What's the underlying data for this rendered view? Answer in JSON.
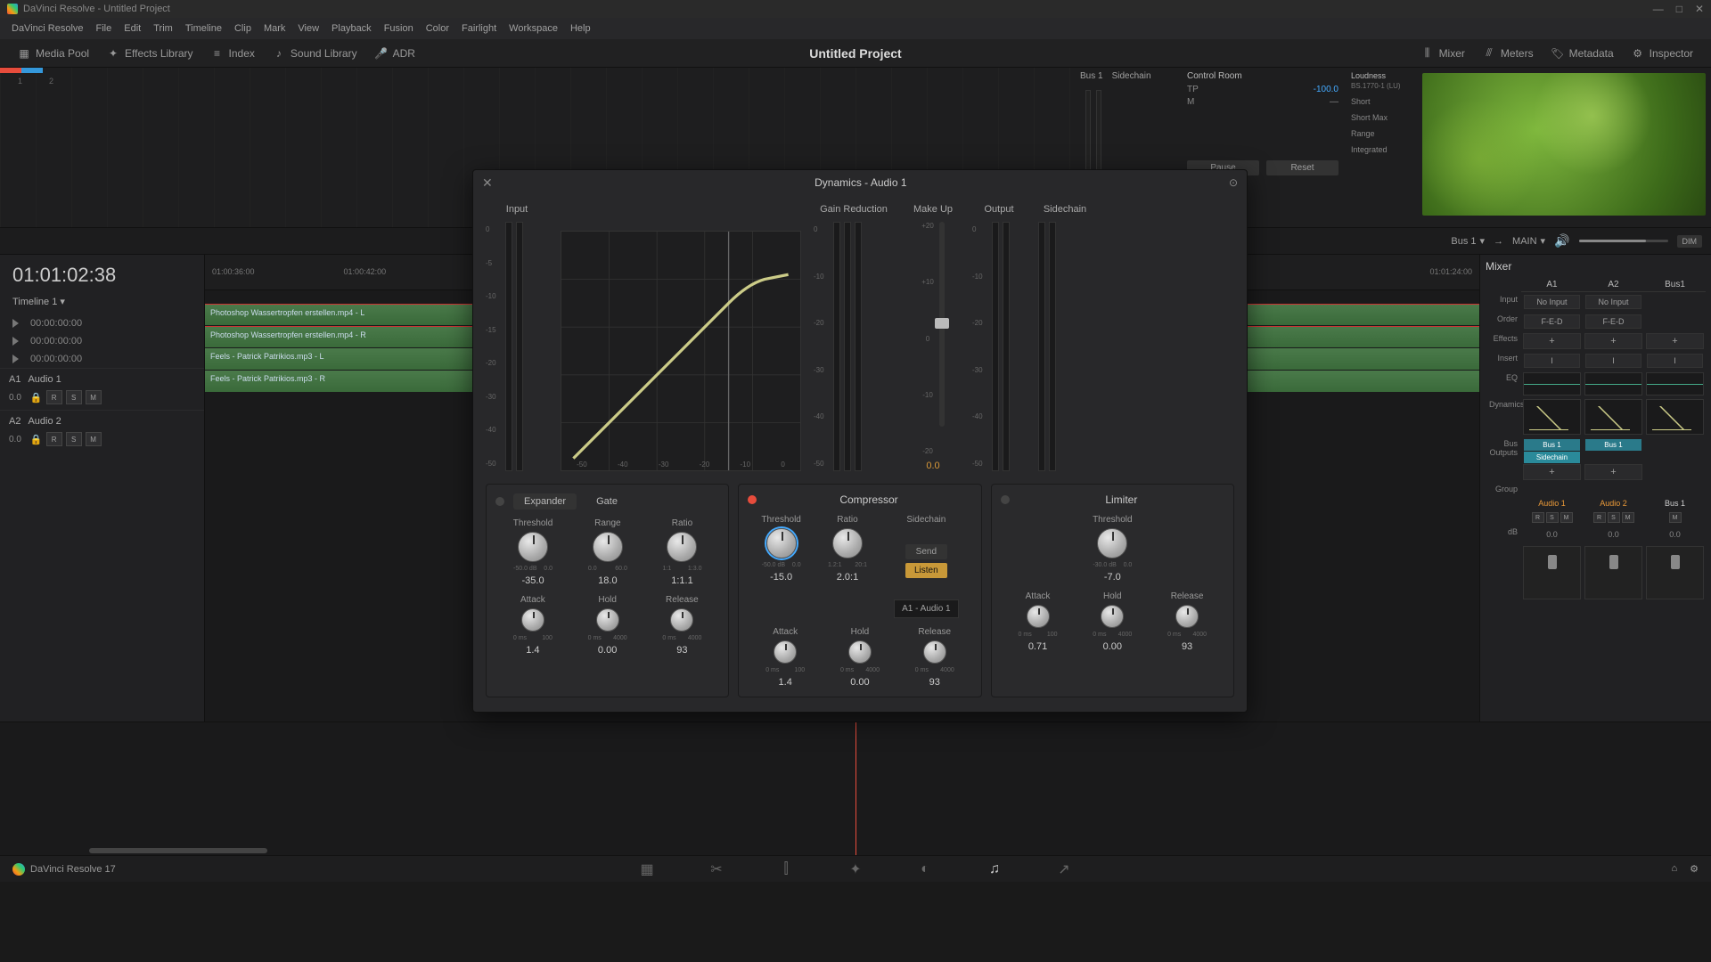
{
  "window": {
    "title": "DaVinci Resolve - Untitled Project"
  },
  "menubar": [
    "DaVinci Resolve",
    "File",
    "Edit",
    "Trim",
    "Timeline",
    "Clip",
    "Mark",
    "View",
    "Playback",
    "Fusion",
    "Color",
    "Fairlight",
    "Workspace",
    "Help"
  ],
  "toolbar": {
    "left": [
      "Media Pool",
      "Effects Library",
      "Index",
      "Sound Library",
      "ADR"
    ],
    "project": "Untitled Project",
    "right": [
      "Mixer",
      "Meters",
      "Metadata",
      "Inspector"
    ]
  },
  "control_room": {
    "bus": "Bus 1",
    "sidechain": "Sidechain",
    "title": "Control Room",
    "tp_label": "TP",
    "tp_value": "-100.0",
    "m_label": "M",
    "loudness_title": "Loudness",
    "loudness_std": "BS.1770-1 (LU)",
    "rows": [
      "Short",
      "Short Max",
      "Range",
      "Integrated"
    ],
    "pause": "Pause",
    "reset": "Reset"
  },
  "midstrip": {
    "bus": "Bus 1",
    "main": "MAIN",
    "dim": "DIM"
  },
  "timeline": {
    "tc": "01:01:02:38",
    "dropdown": "Timeline 1",
    "tc_rows": [
      "00:00:00:00",
      "00:00:00:00",
      "00:00:00:00"
    ],
    "ruler": [
      "01:00:36:00",
      "01:00:42:00",
      "01:01:24:00"
    ],
    "tracks": [
      {
        "id": "A1",
        "name": "Audio 1",
        "level": "0.0",
        "btns": [
          "R",
          "S",
          "M"
        ],
        "clips": [
          "Photoshop Wassertropfen erstellen.mp4 - L",
          "Photoshop Wassertropfen erstellen.mp4 - R"
        ]
      },
      {
        "id": "A2",
        "name": "Audio 2",
        "level": "0.0",
        "btns": [
          "R",
          "S",
          "M"
        ],
        "clips": [
          "Feels - Patrick Patrikios.mp3 - L",
          "Feels - Patrick Patrikios.mp3 - R"
        ]
      }
    ]
  },
  "mixer": {
    "title": "Mixer",
    "channels": [
      "A1",
      "A2",
      "Bus1"
    ],
    "rows": {
      "input": "Input",
      "order": "Order",
      "effects": "Effects",
      "insert": "Insert",
      "eq": "EQ",
      "dynamics": "Dynamics",
      "busout": "Bus Outputs",
      "group": "Group",
      "db": "dB"
    },
    "input_vals": [
      "No Input",
      "No Input",
      ""
    ],
    "order_vals": [
      "F-E-D",
      "F-E-D",
      ""
    ],
    "insert_vals": [
      "I",
      "I",
      "I"
    ],
    "busout": [
      "Bus 1",
      "Bus 1"
    ],
    "sidechain": "Sidechain",
    "names": [
      "Audio 1",
      "Audio 2",
      "Bus 1"
    ],
    "rsm": [
      "R",
      "S",
      "M"
    ],
    "db_vals": [
      "0.0",
      "0.0",
      "0.0"
    ]
  },
  "dynamics": {
    "title": "Dynamics - Audio 1",
    "sections": {
      "input": "Input",
      "gr": "Gain Reduction",
      "makeup": "Make Up",
      "output": "Output",
      "sidechain": "Sidechain"
    },
    "scale": [
      "0",
      "-5",
      "-10",
      "-15",
      "-20",
      "-30",
      "-40",
      "-50"
    ],
    "gr_scale": [
      "0",
      "-10",
      "-20",
      "-30",
      "-40",
      "-50"
    ],
    "mu_scale": [
      "+20",
      "+10",
      "0",
      "-10",
      "-20"
    ],
    "graph_x": [
      "-50",
      "-40",
      "-30",
      "-20",
      "-10",
      "0"
    ],
    "makeup_val": "0.0",
    "expander": {
      "tab1": "Expander",
      "tab2": "Gate",
      "threshold": {
        "label": "Threshold",
        "val": "-35.0",
        "min": "-50.0 dB",
        "max": "0.0"
      },
      "range": {
        "label": "Range",
        "val": "18.0",
        "min": "0.0",
        "max": "60.0"
      },
      "ratio": {
        "label": "Ratio",
        "val": "1:1.1",
        "min": "1:1",
        "max": "1:3.0"
      },
      "attack": {
        "label": "Attack",
        "val": "1.4",
        "min": "0 ms",
        "max": "100"
      },
      "hold": {
        "label": "Hold",
        "val": "0.00",
        "min": "0 ms",
        "max": "4000"
      },
      "release": {
        "label": "Release",
        "val": "93",
        "min": "0 ms",
        "max": "4000"
      }
    },
    "compressor": {
      "title": "Compressor",
      "threshold": {
        "label": "Threshold",
        "val": "-15.0",
        "min": "-50.0 dB",
        "max": "0.0"
      },
      "ratio": {
        "label": "Ratio",
        "val": "2.0:1",
        "min": "1.2:1",
        "max": "20:1"
      },
      "sidechain": {
        "label": "Sidechain",
        "send": "Send",
        "listen": "Listen",
        "source": "A1 - Audio 1"
      },
      "attack": {
        "label": "Attack",
        "val": "1.4",
        "min": "0 ms",
        "max": "100"
      },
      "hold": {
        "label": "Hold",
        "val": "0.00",
        "min": "0 ms",
        "max": "4000"
      },
      "release": {
        "label": "Release",
        "val": "93",
        "min": "0 ms",
        "max": "4000"
      }
    },
    "limiter": {
      "title": "Limiter",
      "threshold": {
        "label": "Threshold",
        "val": "-7.0",
        "min": "-30.0 dB",
        "max": "0.0"
      },
      "attack": {
        "label": "Attack",
        "val": "0.71",
        "min": "0 ms",
        "max": "100"
      },
      "hold": {
        "label": "Hold",
        "val": "0.00",
        "min": "0 ms",
        "max": "4000"
      },
      "release": {
        "label": "Release",
        "val": "93",
        "min": "0 ms",
        "max": "4000"
      }
    }
  },
  "footer": {
    "app": "DaVinci Resolve 17"
  }
}
